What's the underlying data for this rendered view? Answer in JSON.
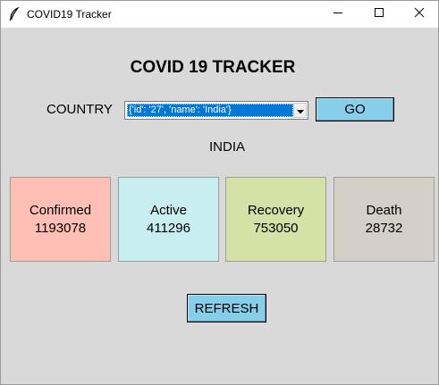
{
  "window": {
    "title": "COVID19 Tracker"
  },
  "heading": "COVID 19 TRACKER",
  "country": {
    "label": "COUNTRY",
    "selected_value": "{'id': '27', 'name': 'India'}",
    "go_label": "GO",
    "name_display": "INDIA"
  },
  "stats": {
    "confirmed": {
      "label": "Confirmed",
      "value": "1193078",
      "color": "#ffbfb4"
    },
    "active": {
      "label": "Active",
      "value": "411296",
      "color": "#c9eef2"
    },
    "recovery": {
      "label": "Recovery",
      "value": "753050",
      "color": "#d4e2a7"
    },
    "death": {
      "label": "Death",
      "value": "28732",
      "color": "#d4d0c8"
    }
  },
  "refresh_label": "REFRESH",
  "icons": {
    "app": "feather-icon",
    "minimize": "minimize-icon",
    "maximize": "maximize-icon",
    "close": "close-icon",
    "dropdown": "chevron-down-icon"
  },
  "colors": {
    "window_bg": "#d9d9d9",
    "button_bg": "#87ceeb",
    "selection": "#0078d7"
  }
}
